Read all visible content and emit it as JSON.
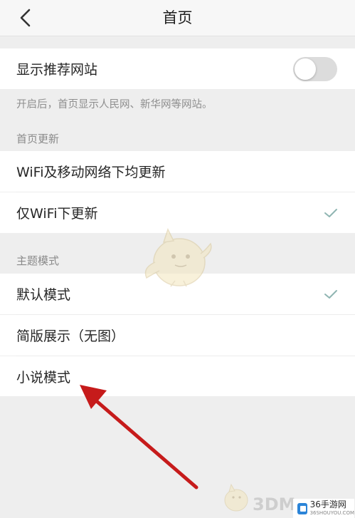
{
  "nav": {
    "title": "首页"
  },
  "recommend": {
    "label": "显示推荐网站",
    "toggle_on": false,
    "note": "开启后，首页显示人民网、新华网等网站。"
  },
  "update_section": {
    "header": "首页更新",
    "options": [
      {
        "label": "WiFi及移动网络下均更新",
        "checked": false
      },
      {
        "label": "仅WiFi下更新",
        "checked": true
      }
    ]
  },
  "theme_section": {
    "header": "主题模式",
    "options": [
      {
        "label": "默认模式",
        "checked": true
      },
      {
        "label": "简版展示（无图）",
        "checked": false
      },
      {
        "label": "小说模式",
        "checked": false
      }
    ]
  },
  "watermark": {
    "brand": "3DM",
    "logo_text": "36手游网",
    "logo_sub": "36SHOUYOU.COM"
  },
  "colors": {
    "check": "#8fb5b2",
    "arrow": "#c61b1b",
    "toggle_off": "#dcdcdc"
  }
}
